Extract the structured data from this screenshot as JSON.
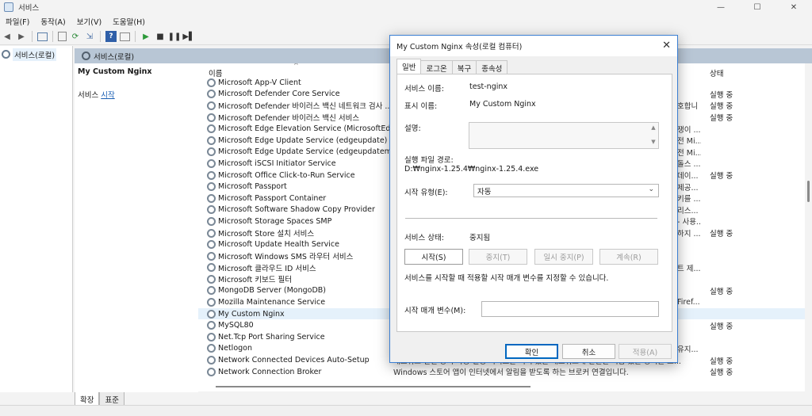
{
  "window": {
    "title": "서비스"
  },
  "menu": [
    "파일(F)",
    "동작(A)",
    "보기(V)",
    "도움말(H)"
  ],
  "tree": {
    "root": "서비스(로컬)"
  },
  "header": {
    "title": "서비스(로컬)"
  },
  "desc": {
    "service_name": "My Custom Nginx",
    "action_prefix": "서비스 ",
    "action_link": "시작"
  },
  "list": {
    "col_name": "이름",
    "col_status": "상태",
    "rows": [
      {
        "name": "Microsoft App-V Client",
        "desc": "",
        "status": ""
      },
      {
        "name": "Microsoft Defender Core Service",
        "desc": "",
        "status": "실행 중"
      },
      {
        "name": "Microsoft Defender 바이러스 백신 네트워크 검사 ...",
        "desc": "호합니",
        "status": "실행 중"
      },
      {
        "name": "Microsoft Defender 바이러스 백신 서비스",
        "desc": "",
        "status": "실행 중"
      },
      {
        "name": "Microsoft Edge Elevation Service (MicrosoftEdgeEl...",
        "desc": "쟁이 ...",
        "status": ""
      },
      {
        "name": "Microsoft Edge Update Service (edgeupdate)",
        "desc": "전 Mi...",
        "status": ""
      },
      {
        "name": "Microsoft Edge Update Service (edgeupdatem)",
        "desc": "전 Mi...",
        "status": ""
      },
      {
        "name": "Microsoft iSCSI Initiator Service",
        "desc": "돌스 ...",
        "status": ""
      },
      {
        "name": "Microsoft Office Click-to-Run Service",
        "desc": "데이...",
        "status": "실행 중"
      },
      {
        "name": "Microsoft Passport",
        "desc": "제공...",
        "status": ""
      },
      {
        "name": "Microsoft Passport Container",
        "desc": "키를 ...",
        "status": ""
      },
      {
        "name": "Microsoft Software Shadow Copy Provider",
        "desc": "리스...",
        "status": ""
      },
      {
        "name": "Microsoft Storage Spaces SMP",
        "desc": "- 사용...",
        "status": ""
      },
      {
        "name": "Microsoft Store 설치 서비스",
        "desc": "하지 ...",
        "status": "실행 중"
      },
      {
        "name": "Microsoft Update Health Service",
        "desc": "",
        "status": ""
      },
      {
        "name": "Microsoft Windows SMS 라우터 서비스",
        "desc": "",
        "status": ""
      },
      {
        "name": "Microsoft 클라우드 ID 서비스",
        "desc": "트 제...",
        "status": ""
      },
      {
        "name": "Microsoft 키보드 필터",
        "desc": "",
        "status": ""
      },
      {
        "name": "MongoDB Server (MongoDB)",
        "desc": "",
        "status": "실행 중"
      },
      {
        "name": "Mozilla Maintenance Service",
        "desc": "Firef...",
        "status": ""
      },
      {
        "name": "My Custom Nginx",
        "desc": "",
        "status": ""
      },
      {
        "name": "MySQL80",
        "desc": "",
        "status": "실행 중"
      },
      {
        "name": "Net.Tcp Port Sharing Service",
        "desc": "",
        "status": ""
      },
      {
        "name": "Netlogon",
        "desc": "유지...",
        "status": ""
      },
      {
        "name": "Network Connected Devices Auto-Setup",
        "desc": "",
        "status": "실행 중"
      },
      {
        "name": "Network Connection Broker",
        "desc": "",
        "status": "실행 중"
      }
    ],
    "partial_desc_1": "네트워크 연결 장치 자동 설정 서비스는 지역 있는 네트워크에 연결된 적합 있는 장치를 모...",
    "partial_desc_2": "Windows 스토어 앱이 인터넷에서 알림을 받도록 하는 브로커 연결입니다."
  },
  "bottom_tabs": [
    "확장",
    "표준"
  ],
  "dialog": {
    "title": "My Custom Nginx 속성(로컬 컴퓨터)",
    "tabs": [
      "일반",
      "로그온",
      "복구",
      "종속성"
    ],
    "service_name_label": "서비스 이름:",
    "service_name_value": "test-nginx",
    "display_name_label": "표시 이름:",
    "display_name_value": "My Custom Nginx",
    "description_label": "설명:",
    "exe_path_label": "실행 파일 경로:",
    "exe_path_value": "D:₩nginx-1.25.4₩nginx-1.25.4.exe",
    "startup_type_label": "시작 유형(E):",
    "startup_type_value": "자동",
    "service_status_label": "서비스 상태:",
    "service_status_value": "중지됨",
    "btn_start": "시작(S)",
    "btn_stop": "중지(T)",
    "btn_pause": "일시 중지(P)",
    "btn_resume": "계속(R)",
    "hint": "서비스를 시작할 때 적용할 시작 매개 변수를 지정할 수 있습니다.",
    "start_params_label": "시작 매개 변수(M):",
    "start_params_value": "",
    "ok": "확인",
    "cancel": "취소",
    "apply": "적용(A)"
  }
}
